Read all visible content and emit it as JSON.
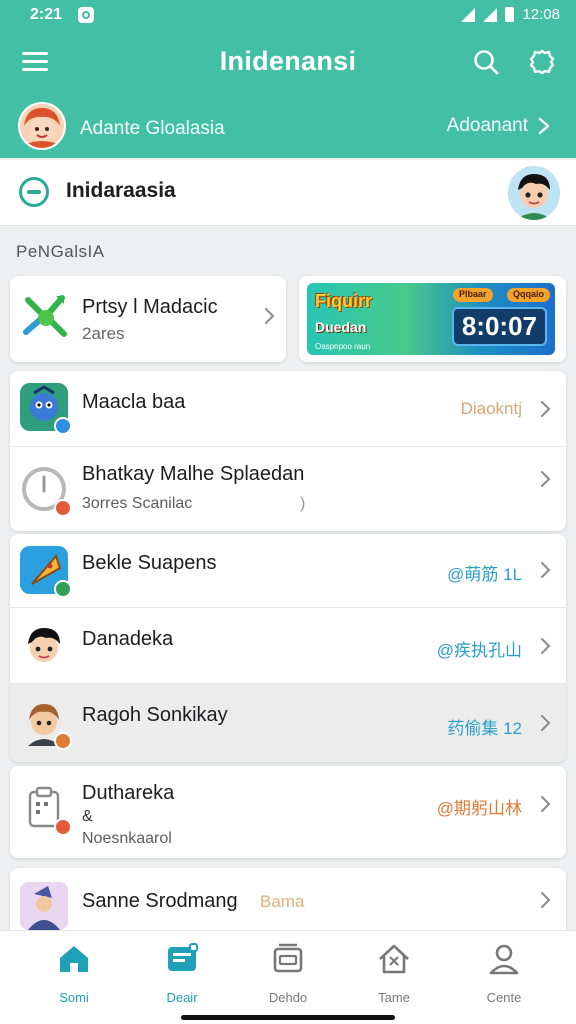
{
  "status_bar": {
    "time": "2:21",
    "clock": "12:08"
  },
  "header": {
    "title": "Inidenansi",
    "menu_icon": "hamburger-icon",
    "search_icon": "search-icon",
    "settings_icon": "gear-icon"
  },
  "account": {
    "name": "Adante Gloalasia",
    "link_label": "Adoanant"
  },
  "search_card": {
    "title": "Inidaraasia"
  },
  "section": {
    "label": "PeNGalsIA"
  },
  "promo": {
    "title": "Prtsy l Madacic",
    "subtitle": "2ares",
    "banner": {
      "word": "Fiquirr",
      "word2": "Duedan",
      "chip1": "Plbaar",
      "chip2": "Qqqaio",
      "time": "8:0:07",
      "footer": "Oaspnpoo raun"
    }
  },
  "list_group_1": [
    {
      "name": "Maacla baa",
      "meta": "Diaokntj",
      "meta_color": "#d4a675"
    },
    {
      "name": "Bhatkay Malhe Splaedan",
      "sub": "3orres Scanilac",
      "sub_mark": ")"
    }
  ],
  "list_group_2": [
    {
      "name": "Bekle Suapens",
      "meta": "@萌筋 1L",
      "meta_color": "#2b9fc6"
    },
    {
      "name": "Danadeka",
      "meta": "@疾执孔山",
      "meta_color": "#2b9fc6"
    },
    {
      "name": "Ragoh Sonkikay",
      "meta": "药偷集 12",
      "meta_color": "#2b9fc6",
      "meta_num": "12",
      "meta_num_color": "#e07b35"
    }
  ],
  "list_group_3": [
    {
      "name": "Duthareka",
      "sub_mark": "&",
      "sub": "Noesnkaarol",
      "meta": "@期躬山林",
      "meta_color": "#e07b35"
    }
  ],
  "list_group_4": [
    {
      "name": "Sanne Srodmang",
      "tag": "Bama",
      "tag_color": "#e2b07c"
    }
  ],
  "bottom_nav": [
    {
      "label": "Somi",
      "icon": "home-icon",
      "active": true
    },
    {
      "label": "Deair",
      "icon": "device-icon",
      "active": true
    },
    {
      "label": "Dehdo",
      "icon": "box-icon",
      "active": false
    },
    {
      "label": "Tame",
      "icon": "house-icon",
      "active": false
    },
    {
      "label": "Cente",
      "icon": "person-icon",
      "active": false
    }
  ],
  "colors": {
    "primary": "#43bfa6",
    "accent_blue": "#1ea0b6",
    "orange": "#e07b35"
  }
}
